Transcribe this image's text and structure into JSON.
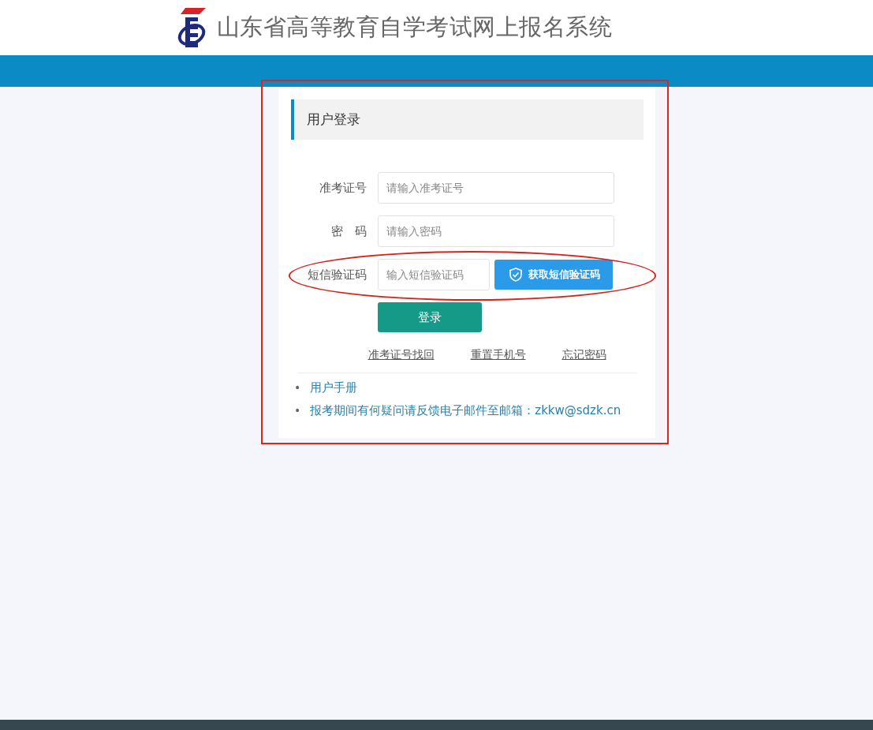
{
  "header": {
    "title": "山东省高等教育自学考试网上报名系统"
  },
  "login": {
    "title": "用户登录",
    "fields": [
      {
        "label": "准考证号",
        "placeholder": "请输入准考证号",
        "kind": "text"
      },
      {
        "label": "密　码",
        "placeholder": "请输入密码",
        "kind": "password"
      },
      {
        "label": "短信验证码",
        "placeholder": "输入短信验证码",
        "kind": "sms",
        "button": "获取短信验证码"
      }
    ],
    "submit": "登录",
    "links": [
      "准考证号找回",
      "重置手机号",
      "忘记密码"
    ],
    "notes": [
      {
        "bullet": "•",
        "text": "用户手册"
      },
      {
        "bullet": "•",
        "text": "报考期间有何疑问请反馈电子邮件至邮箱：zkkw@sdzk.cn"
      }
    ]
  }
}
